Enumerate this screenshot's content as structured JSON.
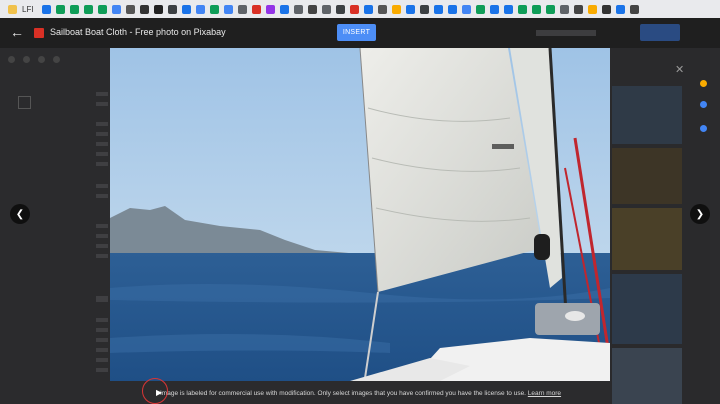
{
  "bookmarks": {
    "first_label": "LFI"
  },
  "header": {
    "back_icon": "arrow-left-icon",
    "title": "Sailboat Boat Cloth - Free photo on Pixabay",
    "insert_label": "INSERT"
  },
  "viewer": {
    "prev_icon": "chevron-left-icon",
    "next_icon": "chevron-right-icon",
    "close_icon": "close-icon"
  },
  "footer": {
    "caption": "Image is labeled for commercial use with modification. Only select images that you have confirmed you have the license to use.",
    "learn_more": "Learn more"
  },
  "colors": {
    "insert_button": "#4d8ef6",
    "background": "#1d1d1f",
    "highlight_circle": "#d93535"
  }
}
